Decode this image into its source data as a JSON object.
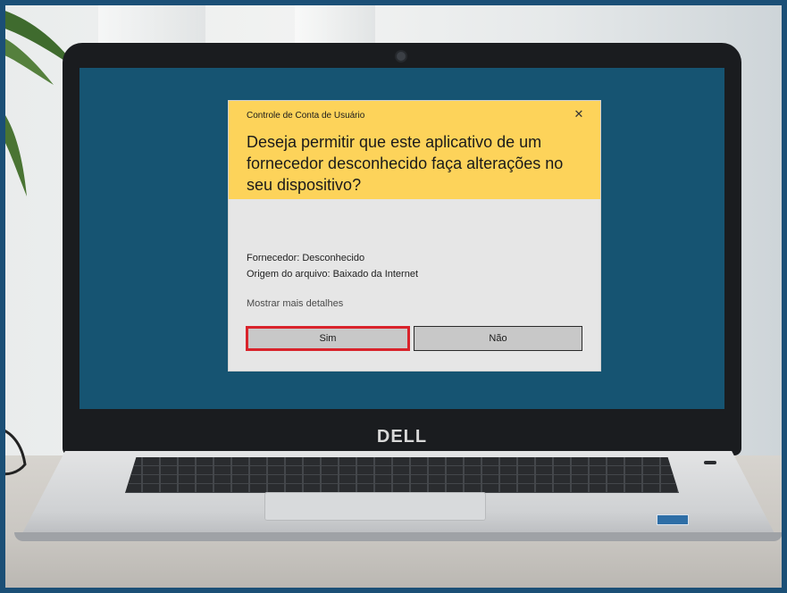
{
  "laptop": {
    "brand": "DELL"
  },
  "dialog": {
    "title": "Controle de Conta de Usuário",
    "close_icon": "close-icon",
    "question": "Deseja permitir que este aplicativo de um fornecedor desconhecido faça alterações no seu dispositivo?",
    "publisher": "Fornecedor: Desconhecido",
    "file_origin": "Origem do arquivo: Baixado da Internet",
    "show_details": "Mostrar mais detalhes",
    "yes_label": "Sim",
    "no_label": "Não",
    "highlight_color": "#d9232b",
    "header_color": "#fdd35a"
  },
  "colors": {
    "screen_background": "#165472",
    "frame_border": "#1b4f76"
  }
}
